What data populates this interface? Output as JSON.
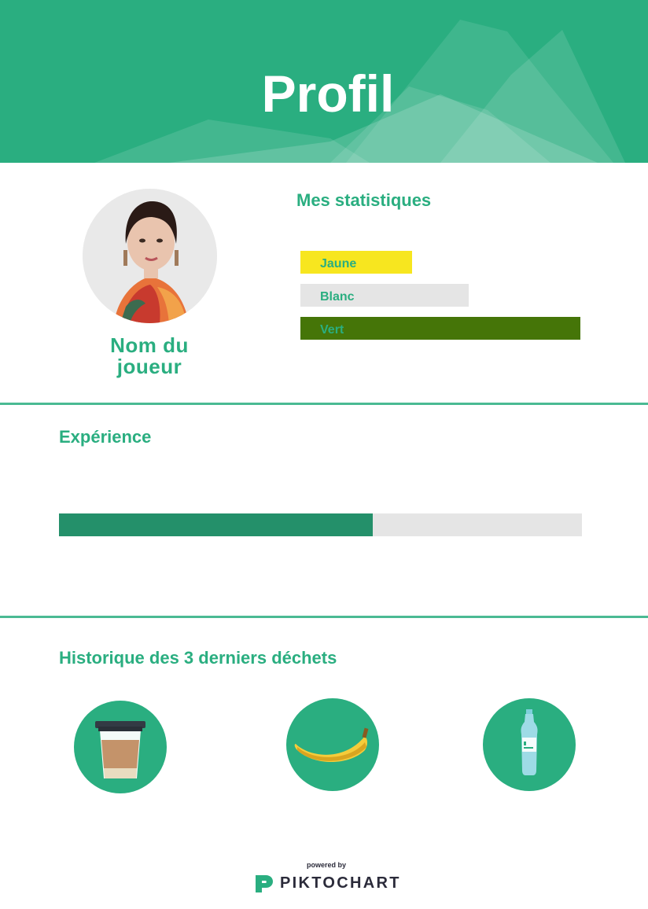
{
  "header": {
    "title": "Profil",
    "bg_color": "#2aae80"
  },
  "profile": {
    "player_name": "Nom du joueur",
    "avatar_icon": "player-photo"
  },
  "stats": {
    "heading": "Mes statistiques",
    "bars": [
      {
        "label": "Jaune",
        "color": "#f7e61f",
        "value": 0.4
      },
      {
        "label": "Blanc",
        "color": "#e5e5e5",
        "value": 0.6
      },
      {
        "label": "Vert",
        "color": "#457508",
        "value": 1.0
      }
    ]
  },
  "experience": {
    "heading": "Expérience",
    "progress": 0.6,
    "fill_color": "#24906a",
    "track_color": "#e5e5e5"
  },
  "history": {
    "heading": "Historique des 3 derniers déchets",
    "items": [
      {
        "icon": "coffee-cup-icon"
      },
      {
        "icon": "banana-icon"
      },
      {
        "icon": "water-bottle-icon"
      }
    ]
  },
  "footer": {
    "powered_by": "powered by",
    "brand": "PIKTOCHART"
  }
}
